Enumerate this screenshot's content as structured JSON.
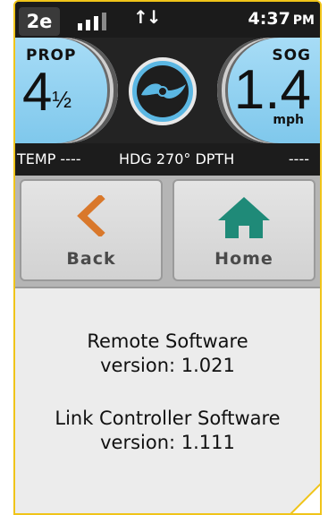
{
  "status": {
    "badge": "2e",
    "time": "4:37",
    "ampm": "PM",
    "signal_bars_active": 3,
    "signal_bars_total": 4
  },
  "gauges": {
    "prop_label": "PROP",
    "prop_value": "4",
    "prop_fraction": "½",
    "sog_label": "SOG",
    "sog_value": "1.4",
    "sog_unit": "mph"
  },
  "info_row": {
    "temp": "TEMP ----",
    "heading": "HDG 270° DPTH",
    "depth_value": "----"
  },
  "nav": {
    "back_label": "Back",
    "home_label": "Home"
  },
  "content": {
    "remote_title": "Remote Software",
    "remote_version": "version: 1.021",
    "link_title": "Link Controller Software",
    "link_version": "version: 1.111"
  },
  "colors": {
    "frame": "#f0c419",
    "gauge_fill": "#8ecfee",
    "back_accent": "#d9782b",
    "home_accent": "#1f8a78",
    "center_icon": "#5bb7e3"
  },
  "icons": {
    "back": "chevron-left-icon",
    "home": "house-icon",
    "center": "propeller-icon",
    "transfer": "up-down-arrows-icon",
    "signal": "signal-bars-icon"
  }
}
